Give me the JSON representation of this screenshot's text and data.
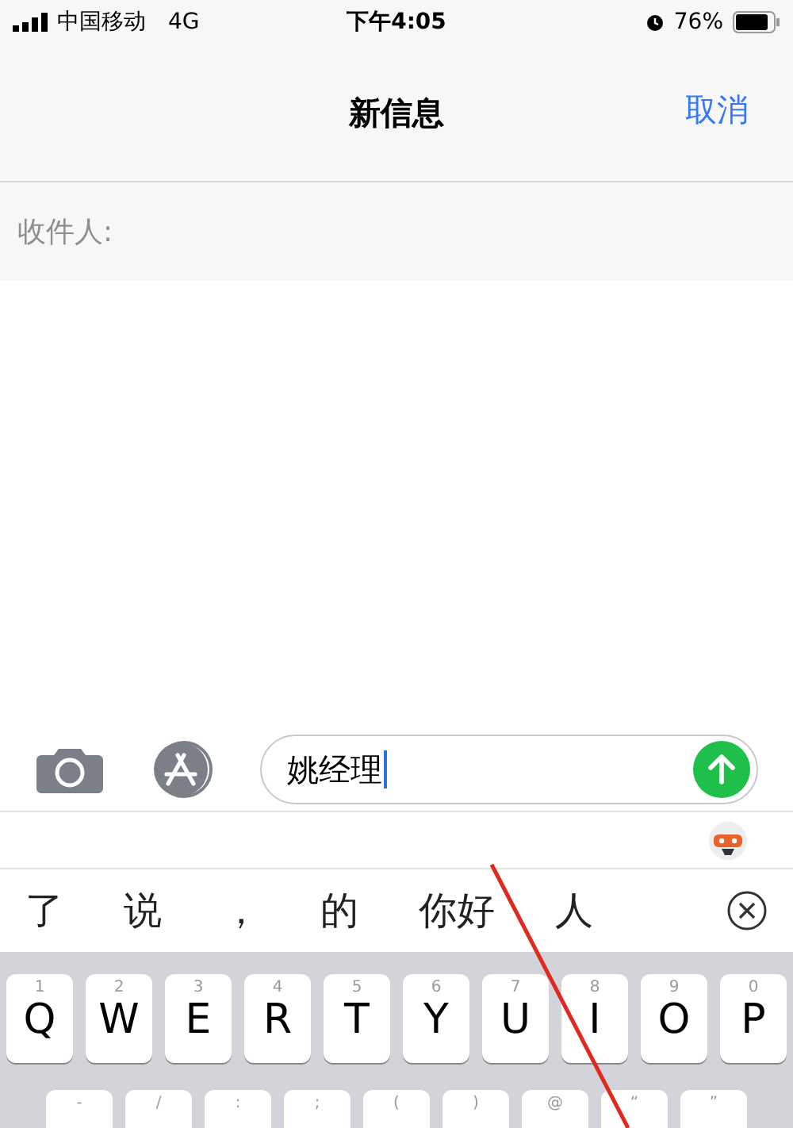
{
  "status_bar": {
    "carrier": "中国移动",
    "network": "4G",
    "time": "下午4:05",
    "battery": "76%"
  },
  "nav_bar": {
    "title": "新信息",
    "action": "取消"
  },
  "recipient": {
    "label": "收件人:"
  },
  "composer": {
    "value": "姚经理"
  },
  "candidates": [
    "了",
    "说",
    "，",
    "的",
    "你好",
    "人"
  ],
  "keyboard": {
    "rows": [
      [
        {
          "hint": "1",
          "key": "Q"
        },
        {
          "hint": "2",
          "key": "W"
        },
        {
          "hint": "3",
          "key": "E"
        },
        {
          "hint": "4",
          "key": "R"
        },
        {
          "hint": "5",
          "key": "T"
        },
        {
          "hint": "6",
          "key": "Y"
        },
        {
          "hint": "7",
          "key": "U"
        },
        {
          "hint": "8",
          "key": "I"
        },
        {
          "hint": "9",
          "key": "O"
        },
        {
          "hint": "0",
          "key": "P"
        }
      ],
      [
        {
          "hint": "-"
        },
        {
          "hint": "/"
        },
        {
          "hint": ":"
        },
        {
          "hint": ";"
        },
        {
          "hint": "("
        },
        {
          "hint": ")"
        },
        {
          "hint": "@"
        },
        {
          "hint": "“"
        },
        {
          "hint": "”"
        }
      ]
    ]
  }
}
